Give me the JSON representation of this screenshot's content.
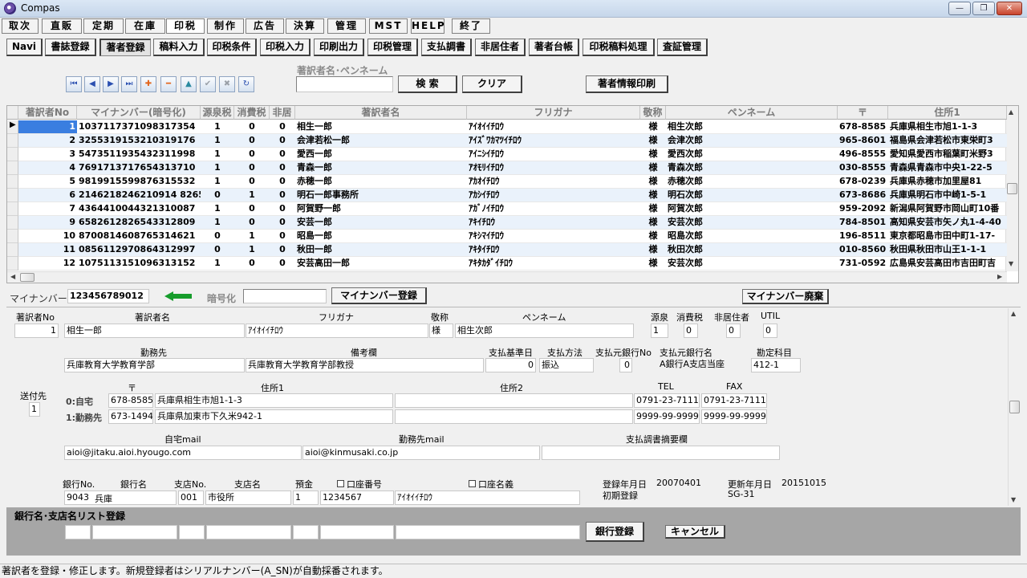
{
  "window": {
    "title": "Compas",
    "minimize": "—",
    "restore": "❐",
    "close": "✕"
  },
  "menu": [
    "取次",
    "直販",
    "定期",
    "在庫",
    "印税",
    "制作",
    "広告",
    "決算",
    "管理",
    "MST",
    "HELP",
    "終了"
  ],
  "tabs": [
    "Navi",
    "書誌登録",
    "著者登録",
    "稿料入力",
    "印税条件",
    "印税入力",
    "印刷出力",
    "印税管理",
    "支払調書",
    "非居住者",
    "著者台帳",
    "印税稿料処理",
    "査証管理"
  ],
  "toolbar": {
    "search_label": "著訳者名･ペンネーム",
    "search_value": "",
    "search_button": "検 索",
    "clear_button": "クリア",
    "print_button": "著者情報印刷",
    "nav_icons": [
      "⏮",
      "◀",
      "▶",
      "⏭",
      "✚",
      "━",
      "▲",
      "✔",
      "✖",
      "↻"
    ]
  },
  "grid": {
    "columns": [
      "著訳者No",
      "マイナンバー(暗号化)",
      "源泉税",
      "消費税",
      "非居",
      "著訳者名",
      "フリガナ",
      "敬称",
      "ペンネーム",
      "〒",
      "住所1"
    ],
    "rows": [
      [
        "1",
        "1037117371098317354",
        "1",
        "0",
        "0",
        "相生一郎",
        "ｱｲｵｲｲﾁﾛｳ",
        "様",
        "相生次郎",
        "678-8585",
        "兵庫県相生市旭1-1-3"
      ],
      [
        "2",
        "3255319153210319176",
        "1",
        "0",
        "0",
        "会津若松一郎",
        "ｱｲｽﾞﾜｶﾏﾂｲﾁﾛｳ",
        "様",
        "会津次郎",
        "965-8601",
        "福島県会津若松市東栄町3"
      ],
      [
        "3",
        "5473511935432311998",
        "1",
        "0",
        "0",
        "愛西一郎",
        "ｱｲﾆｼｲﾁﾛｳ",
        "様",
        "愛西次郎",
        "496-8555",
        "愛知県愛西市稲葉町米野3"
      ],
      [
        "4",
        "7691713717654313710",
        "1",
        "0",
        "0",
        "青森一郎",
        "ｱｵﾓﾘｲﾁﾛｳ",
        "様",
        "青森次郎",
        "030-8555",
        "青森県青森市中央1-22-5"
      ],
      [
        "5",
        "9819915599876315532",
        "1",
        "0",
        "0",
        "赤穂一郎",
        "ｱｶｵｲﾁﾛｳ",
        "様",
        "赤穂次郎",
        "678-0239",
        "兵庫県赤穂市加里屋81"
      ],
      [
        "6",
        "2146218246210914 8265",
        "0",
        "1",
        "0",
        "明石一郎事務所",
        "ｱｶｼｲﾁﾛｳ",
        "様",
        "明石次郎",
        "673-8686",
        "兵庫県明石市中崎1-5-1"
      ],
      [
        "7",
        "4364410044321310087",
        "1",
        "0",
        "0",
        "阿賀野一郎",
        "ｱｶﾞﾉｲﾁﾛｳ",
        "様",
        "阿賀次郎",
        "959-2092",
        "新潟県阿賀野市岡山町10番"
      ],
      [
        "9",
        "6582612826543312809",
        "1",
        "0",
        "0",
        "安芸一郎",
        "ｱｷｲﾁﾛｳ",
        "様",
        "安芸次郎",
        "784-8501",
        "高知県安芸市矢ノ丸1-4-40"
      ],
      [
        "10",
        "8700814608765314621",
        "0",
        "1",
        "0",
        "昭島一郎",
        "ｱｷｼﾏｲﾁﾛｳ",
        "様",
        "昭島次郎",
        "196-8511",
        "東京都昭島市田中町1-17-"
      ],
      [
        "11",
        "0856112970864312997",
        "0",
        "1",
        "0",
        "秋田一郎",
        "ｱｷﾀｲﾁﾛｳ",
        "様",
        "秋田次郎",
        "010-8560",
        "秋田県秋田市山王1-1-1"
      ],
      [
        "12",
        "1075113151096313152",
        "1",
        "0",
        "0",
        "安芸高田一郎",
        "ｱｷﾀｶﾀﾞｲﾁﾛｳ",
        "様",
        "安芸次郎",
        "731-0592",
        "広島県安芸高田市吉田町吉"
      ]
    ]
  },
  "mynumber": {
    "label": "マイナンバー",
    "value": "123456789012",
    "encrypt_label": "暗号化",
    "encrypt_value": "",
    "register_button": "マイナンバー登録",
    "discard_button": "マイナンバー廃棄"
  },
  "detail": {
    "labels": {
      "no": "著訳者No",
      "name": "著訳者名",
      "kana": "フリガナ",
      "honorific": "敬称",
      "penname": "ペンネーム",
      "gensen": "源泉",
      "shohi": "消費税",
      "hikyo": "非居住者",
      "util": "UTIL",
      "workplace": "勤務先",
      "remarks": "備考欄",
      "pay_date": "支払基準日",
      "pay_method": "支払方法",
      "bank_no": "支払元銀行No",
      "bank_name": "支払元銀行名",
      "account": "勘定科目",
      "sendto": "送付先",
      "zip": "〒",
      "addr1": "住所1",
      "addr2": "住所2",
      "tel": "TEL",
      "fax": "FAX",
      "home_row": "0:自宅",
      "work_row": "1:勤務先",
      "home_mail": "自宅mail",
      "work_mail": "勤務先mail",
      "summary": "支払調書摘要欄",
      "bankno": "銀行No.",
      "bankname": "銀行名",
      "branchno": "支店No.",
      "branchname": "支店名",
      "deposit": "預金",
      "accno": "口座番号",
      "accname": "口座名義",
      "reg_date": "登録年月日",
      "upd_date": "更新年月日"
    },
    "values": {
      "no": "1",
      "name": "相生一郎",
      "kana": "ｱｲｵｲｲﾁﾛｳ",
      "honorific": "様",
      "penname": "相生次郎",
      "gensen": "1",
      "shohi": "0",
      "hikyo": "0",
      "util": "0",
      "workplace": "兵庫教育大学教育学部",
      "remarks": "兵庫教育大学教育学部教授",
      "pay_date": "0",
      "pay_method": "振込",
      "bank_no": "0",
      "bank_name": "A銀行A支店当座",
      "account": "412-1",
      "sendto": "1",
      "home_zip": "678-8585",
      "home_addr1": "兵庫県相生市旭1-1-3",
      "home_addr2": "",
      "home_tel": "0791-23-7111",
      "home_fax": "0791-23-7111",
      "work_zip": "673-1494",
      "work_addr1": "兵庫県加東市下久米942-1",
      "work_addr2": "",
      "work_tel": "9999-99-9999",
      "work_fax": "9999-99-9999",
      "home_mail": "aioi@jitaku.aioi.hyougo.com",
      "work_mail": "aioi@kinmusaki.co.jp",
      "summary": "",
      "bankno": "9043",
      "bankname": "兵庫",
      "branchno": "001",
      "branchname": "市役所",
      "deposit": "1",
      "accno": "1234567",
      "accname": "ｱｲｵｲｲﾁﾛｳ",
      "reg_date": "20070401",
      "upd_date": "20151015",
      "reg_note": "初期登録",
      "upd_note": "SG-31"
    }
  },
  "banklist": {
    "title": "銀行名･支店名リスト登録",
    "register_button": "銀行登録",
    "cancel_button": "キャンセル"
  },
  "status": "著訳者を登録・修正します。新規登録者はシリアルナンバー(A_SN)が自動採番されます。"
}
